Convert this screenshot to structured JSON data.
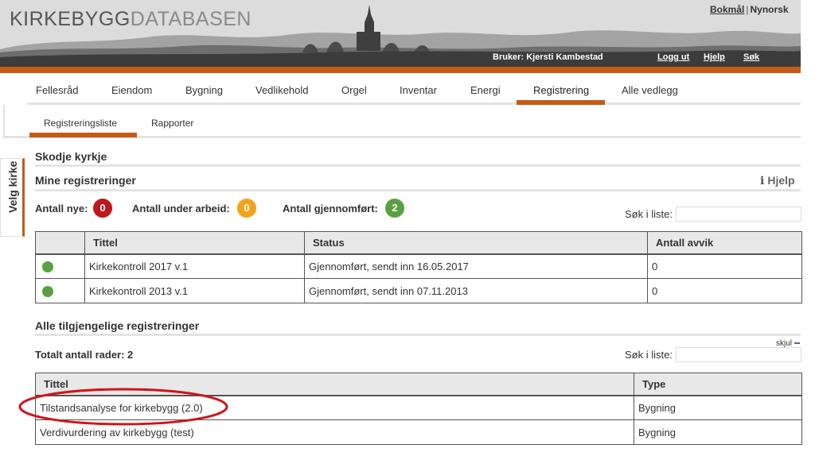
{
  "header": {
    "logo_main": "KIRKEBYGG",
    "logo_sub": "DATABASEN",
    "lang_bokmal": "Bokmål",
    "lang_sep": "|",
    "lang_nynorsk": "Nynorsk",
    "user_prefix": "Bruker:",
    "user_name": "Kjersti Kambestad",
    "logout": "Logg ut",
    "help": "Hjelp",
    "search": "Søk"
  },
  "nav": {
    "items": [
      "Fellesråd",
      "Eiendom",
      "Bygning",
      "Vedlikehold",
      "Orgel",
      "Inventar",
      "Energi",
      "Registrering",
      "Alle vedlegg"
    ],
    "active": "Registrering"
  },
  "subnav": {
    "items": [
      "Registreringsliste",
      "Rapporter"
    ],
    "active": "Registreringsliste"
  },
  "side_tab": "Velg kirke",
  "church_name": "Skodje kyrkje",
  "mine": {
    "title": "Mine registreringer",
    "help": "Hjelp",
    "counts": [
      {
        "label": "Antall nye:",
        "value": "0",
        "color": "#c0161c"
      },
      {
        "label": "Antall under arbeid:",
        "value": "0",
        "color": "#f3a31b"
      },
      {
        "label": "Antall gjennomført:",
        "value": "2",
        "color": "#5aa040"
      }
    ],
    "search_label": "Søk i liste:",
    "columns": [
      "",
      "Tittel",
      "Status",
      "Antall avvik"
    ],
    "rows": [
      {
        "title": "Kirkekontroll 2017 v.1",
        "status": "Gjennomført, sendt inn 16.05.2017",
        "deviations": "0"
      },
      {
        "title": "Kirkekontroll 2013 v.1",
        "status": "Gjennomført, sendt inn 07.11.2013",
        "deviations": "0"
      }
    ]
  },
  "alle": {
    "title": "Alle tilgjengelige registreringer",
    "hide": "skjul",
    "total": "Totalt antall rader: 2",
    "search_label": "Søk i liste:",
    "columns": [
      "Tittel",
      "Type"
    ],
    "rows": [
      {
        "title": "Tilstandsanalyse for kirkebygg (2.0)",
        "type": "Bygning"
      },
      {
        "title": "Verdivurdering av kirkebygg (test)",
        "type": "Bygning"
      }
    ]
  },
  "colors": {
    "accent": "#c65a14",
    "highlight_ellipse": "#d0141c"
  }
}
